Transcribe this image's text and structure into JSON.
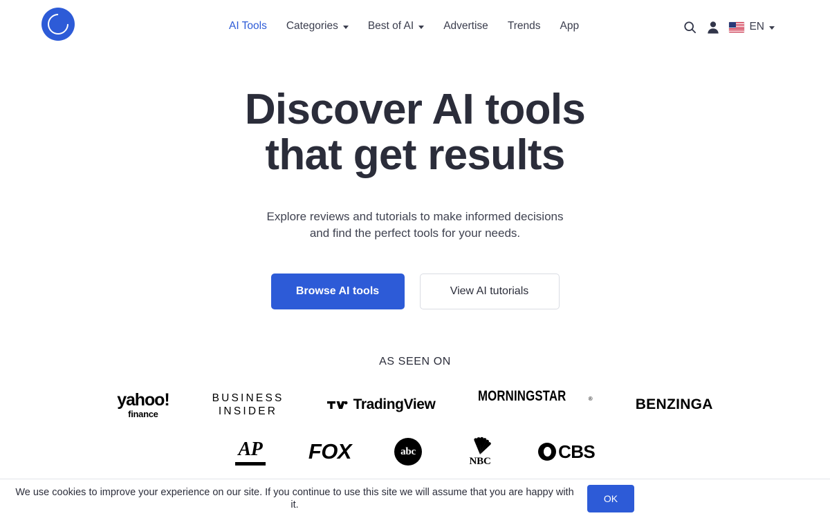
{
  "header": {
    "logo": {
      "icon": "circle-c-logo",
      "letter": "C",
      "color": "#2d5bd7"
    },
    "nav": [
      {
        "label": "AI Tools",
        "active": true,
        "has_caret": false
      },
      {
        "label": "Categories",
        "active": false,
        "has_caret": true
      },
      {
        "label": "Best of AI",
        "active": false,
        "has_caret": true
      },
      {
        "label": "Advertise",
        "active": false,
        "has_caret": false
      },
      {
        "label": "Trends",
        "active": false,
        "has_caret": false
      },
      {
        "label": "App",
        "active": false,
        "has_caret": false
      }
    ],
    "actions": {
      "search_icon": "search-icon",
      "account_icon": "user-icon",
      "language": {
        "flag": "us-flag-icon",
        "label": "EN",
        "caret": "chevron-down-icon"
      }
    }
  },
  "hero": {
    "headline_line1": "Discover AI tools",
    "headline_line2": "that get results",
    "subtitle_line1": "Explore reviews and tutorials to make informed decisions",
    "subtitle_line2": "and find the perfect tools for your needs.",
    "primary_cta": "Browse AI tools",
    "secondary_cta": "View AI tutorials",
    "primary_color": "#2d5bd7"
  },
  "as_seen_on": {
    "label": "AS SEEN ON",
    "row1": [
      {
        "name": "yahoo-finance-logo",
        "main": "yahoo!",
        "sub": "finance"
      },
      {
        "name": "business-insider-logo",
        "line1": "BUSINESS",
        "line2": "INSIDER"
      },
      {
        "name": "tradingview-logo",
        "text": "TradingView"
      },
      {
        "name": "morningstar-logo",
        "text": "MORNINGSTAR",
        "mark": "®"
      },
      {
        "name": "benzinga-logo",
        "text": "BENZINGA"
      }
    ],
    "row2": [
      {
        "name": "ap-logo",
        "text": "AP"
      },
      {
        "name": "fox-logo",
        "text": "FOX"
      },
      {
        "name": "abc-logo",
        "text": "abc"
      },
      {
        "name": "nbc-logo",
        "text": "NBC"
      },
      {
        "name": "cbs-logo",
        "text": "CBS"
      }
    ]
  },
  "cookie_banner": {
    "message": "We use cookies to improve your experience on our site. If you continue to use this site we will assume that you are happy with it.",
    "ok_label": "OK",
    "ok_color": "#2d5bd7"
  }
}
